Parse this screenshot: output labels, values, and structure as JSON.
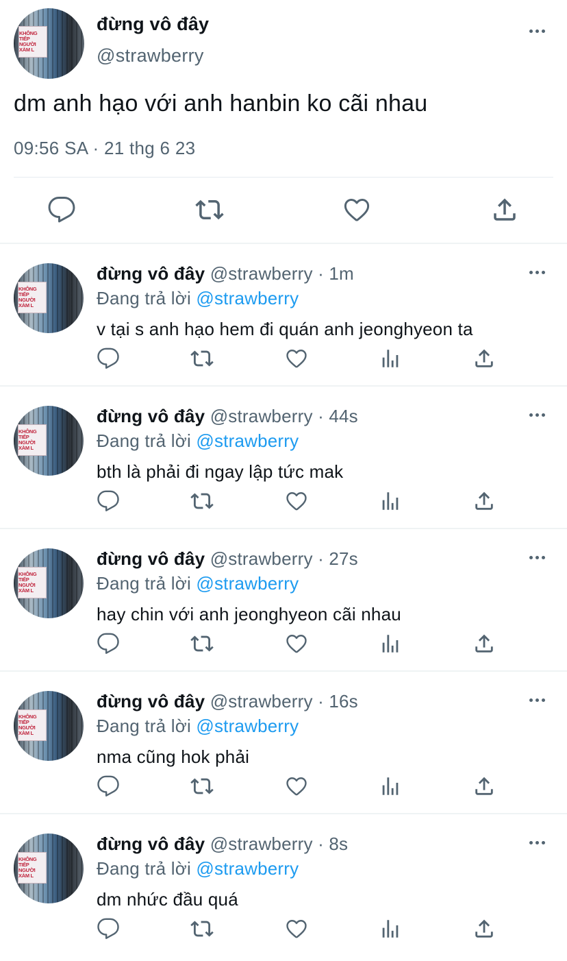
{
  "main_tweet": {
    "author_name": "đừng vô đây",
    "author_handle": "@strawberry",
    "avatar_sign": [
      "KHÔNG TIẾP",
      "NGƯỜI XÀM L"
    ],
    "text": "dm anh hạo với anh hanbin ko cãi nhau",
    "timestamp": "09:56 SA · 21 thg 6 23",
    "actions": [
      "reply-icon",
      "retweet-icon",
      "like-icon",
      "share-icon"
    ]
  },
  "replies": [
    {
      "name": "đừng vô đây",
      "meta": "@strawberry · 1m",
      "replying_label": "Đang trả lời",
      "replying_to": "@strawberry",
      "text": "v tại s anh hạo hem đi quán anh jeonghyeon ta"
    },
    {
      "name": "đừng vô đây",
      "meta": "@strawberry · 44s",
      "replying_label": "Đang trả lời",
      "replying_to": "@strawberry",
      "text": "bth là phải đi ngay lập tức mak"
    },
    {
      "name": "đừng vô đây",
      "meta": "@strawberry · 27s",
      "replying_label": "Đang trả lời",
      "replying_to": "@strawberry",
      "text": "hay chin với anh jeonghyeon cãi nhau"
    },
    {
      "name": "đừng vô đây",
      "meta": "@strawberry · 16s",
      "replying_label": "Đang trả lời",
      "replying_to": "@strawberry",
      "text": "nma cũng hok phải"
    },
    {
      "name": "đừng vô đây",
      "meta": "@strawberry · 8s",
      "replying_label": "Đang trả lời",
      "replying_to": "@strawberry",
      "text": "dm nhức đầu quá"
    }
  ],
  "reply_actions": [
    "reply-icon",
    "retweet-icon",
    "like-icon",
    "views-icon",
    "share-icon"
  ],
  "colors": {
    "text": "#0f1419",
    "secondary": "#536471",
    "link": "#1d9bf0",
    "divider": "#eff3f4"
  }
}
